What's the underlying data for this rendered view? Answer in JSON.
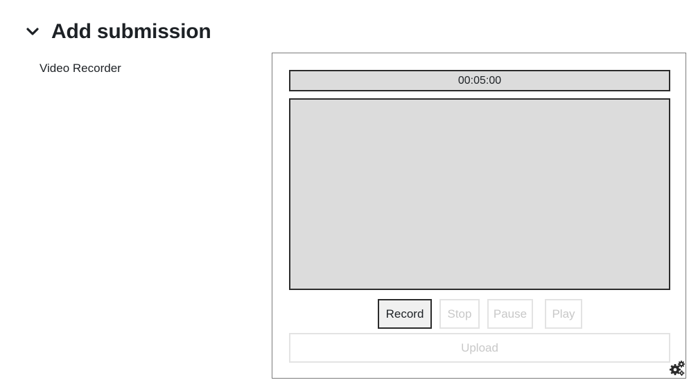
{
  "section": {
    "title": "Add submission",
    "toggle_icon": "chevron-down-icon"
  },
  "field": {
    "label": "Video Recorder"
  },
  "recorder": {
    "timer": "00:05:00",
    "buttons": {
      "record": "Record",
      "stop": "Stop",
      "pause": "Pause",
      "play": "Play"
    },
    "upload_label": "Upload",
    "settings_icon": "gears-icon"
  },
  "colors": {
    "text": "#1d2125",
    "preview_background": "#dcdcdc",
    "border_dark": "#2b2b2b",
    "disabled_text": "#c8c8c8",
    "disabled_border": "#e3e3e3"
  }
}
